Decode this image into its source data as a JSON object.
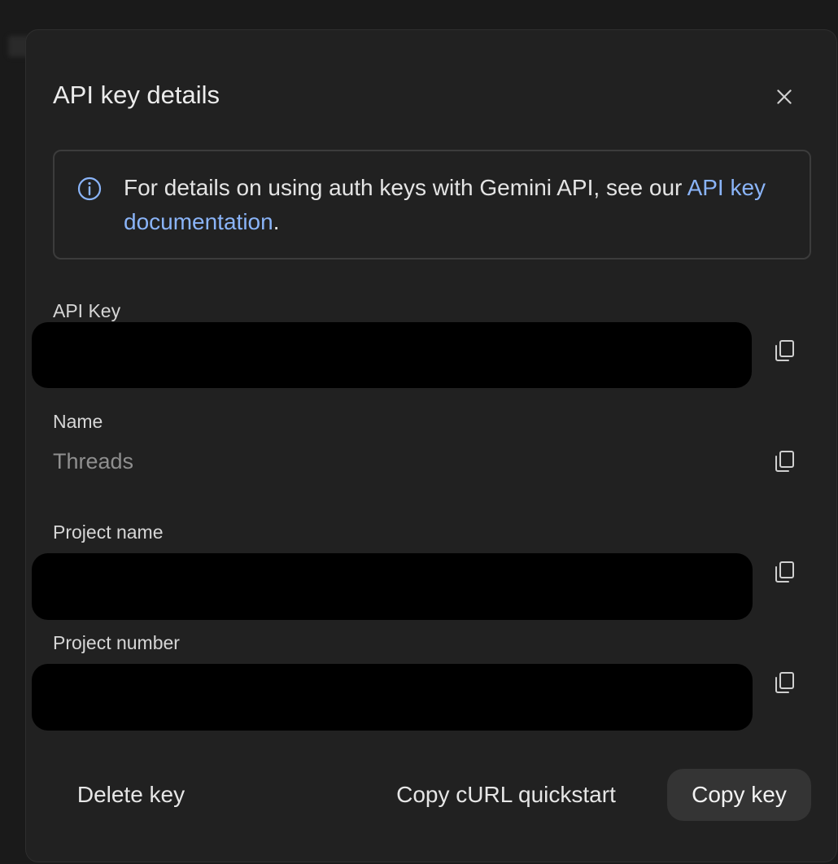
{
  "dialog": {
    "title": "API key details",
    "close_icon": "close-icon"
  },
  "info": {
    "icon": "info-icon",
    "text": "For details on using auth keys with Gemini API, see our ",
    "link_text": "API key documentation",
    "suffix": "."
  },
  "fields": {
    "api_key": {
      "label": "API Key",
      "copy_icon": "copy-icon"
    },
    "name": {
      "label": "Name",
      "value": "Threads",
      "copy_icon": "copy-icon"
    },
    "project_name": {
      "label": "Project name",
      "copy_icon": "copy-icon"
    },
    "project_number": {
      "label": "Project number",
      "copy_icon": "copy-icon"
    }
  },
  "footer": {
    "delete_label": "Delete key",
    "curl_label": "Copy cURL quickstart",
    "copy_key_label": "Copy key"
  },
  "colors": {
    "dialog_bg": "#212121",
    "link": "#8ab4f8",
    "primary_button_bg": "#343434",
    "redaction": "#000000"
  }
}
